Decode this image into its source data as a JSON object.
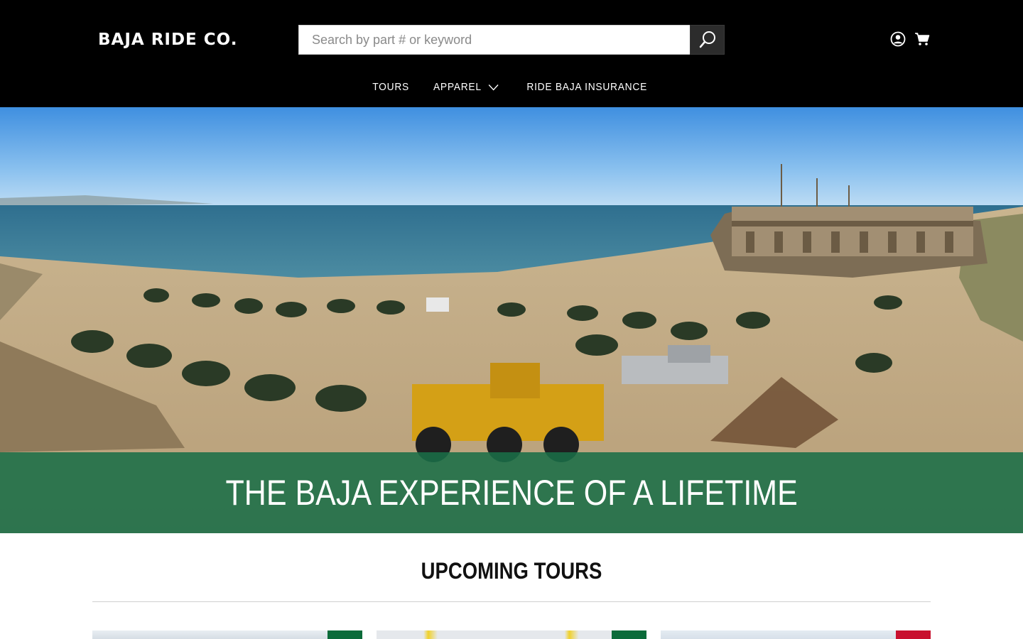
{
  "header": {
    "logo": "BAJA RIDE CO.",
    "search": {
      "placeholder": "Search by part # or keyword",
      "value": ""
    },
    "icons": {
      "search": "search-icon",
      "account": "user-circle-icon",
      "cart": "cart-icon"
    }
  },
  "nav": {
    "items": [
      {
        "label": "TOURS",
        "has_dropdown": false
      },
      {
        "label": "APPAREL",
        "has_dropdown": true
      },
      {
        "label": "RIDE BAJA INSURANCE",
        "has_dropdown": false
      }
    ]
  },
  "hero": {
    "title": "THE BAJA EXPERIENCE OF A LIFETIME",
    "band_color": "#1a6e48"
  },
  "section": {
    "title": "UPCOMING TOURS"
  },
  "cards": [
    {
      "flag_color": "#0b6b3a"
    },
    {
      "flag_color": "#0b6b3a"
    },
    {
      "flag_color": "#c8102e"
    }
  ],
  "colors": {
    "header_bg": "#000000",
    "accent_green": "#1a6e48",
    "accent_red": "#c8102e"
  }
}
